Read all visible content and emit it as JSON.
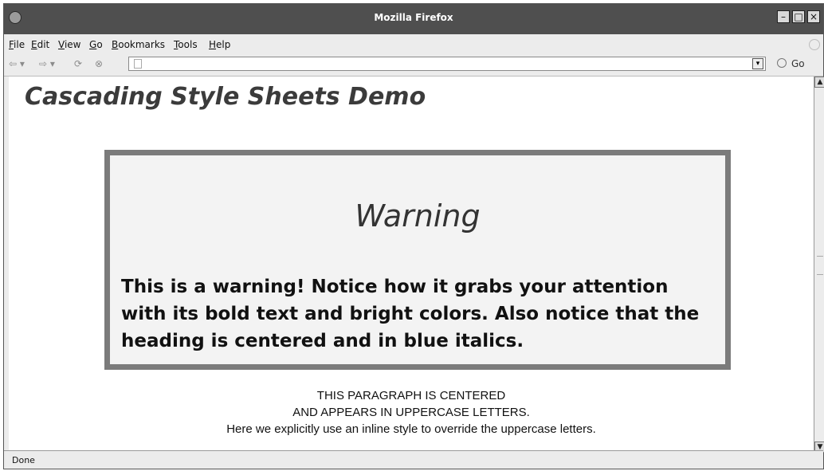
{
  "window": {
    "title": "Mozilla Firefox",
    "buttons": [
      "–",
      "□",
      "×"
    ]
  },
  "menu": {
    "items": [
      {
        "label": "File"
      },
      {
        "label": "Edit"
      },
      {
        "label": "View"
      },
      {
        "label": "Go"
      },
      {
        "label": "Bookmarks"
      },
      {
        "label": "Tools"
      },
      {
        "label": "Help"
      }
    ]
  },
  "nav": {
    "back_icon": "back-arrow-icon",
    "forward_icon": "forward-arrow-icon",
    "reload_icon": "reload-icon",
    "stop_icon": "stop-icon",
    "url_value": "",
    "go_label": "Go"
  },
  "page": {
    "title": "Cascading Style Sheets Demo",
    "warning": {
      "heading": "Warning",
      "text": "This is a warning! Notice how it grabs your attention with its bold text and bright colors. Also notice that the heading is centered and in blue italics."
    },
    "paragraph": {
      "line1": "This paragraph is centered",
      "line2": "and appears in uppercase letters.",
      "line3": "Here we explicitly use an inline style to override the uppercase letters."
    }
  },
  "status": {
    "text": "Done"
  }
}
